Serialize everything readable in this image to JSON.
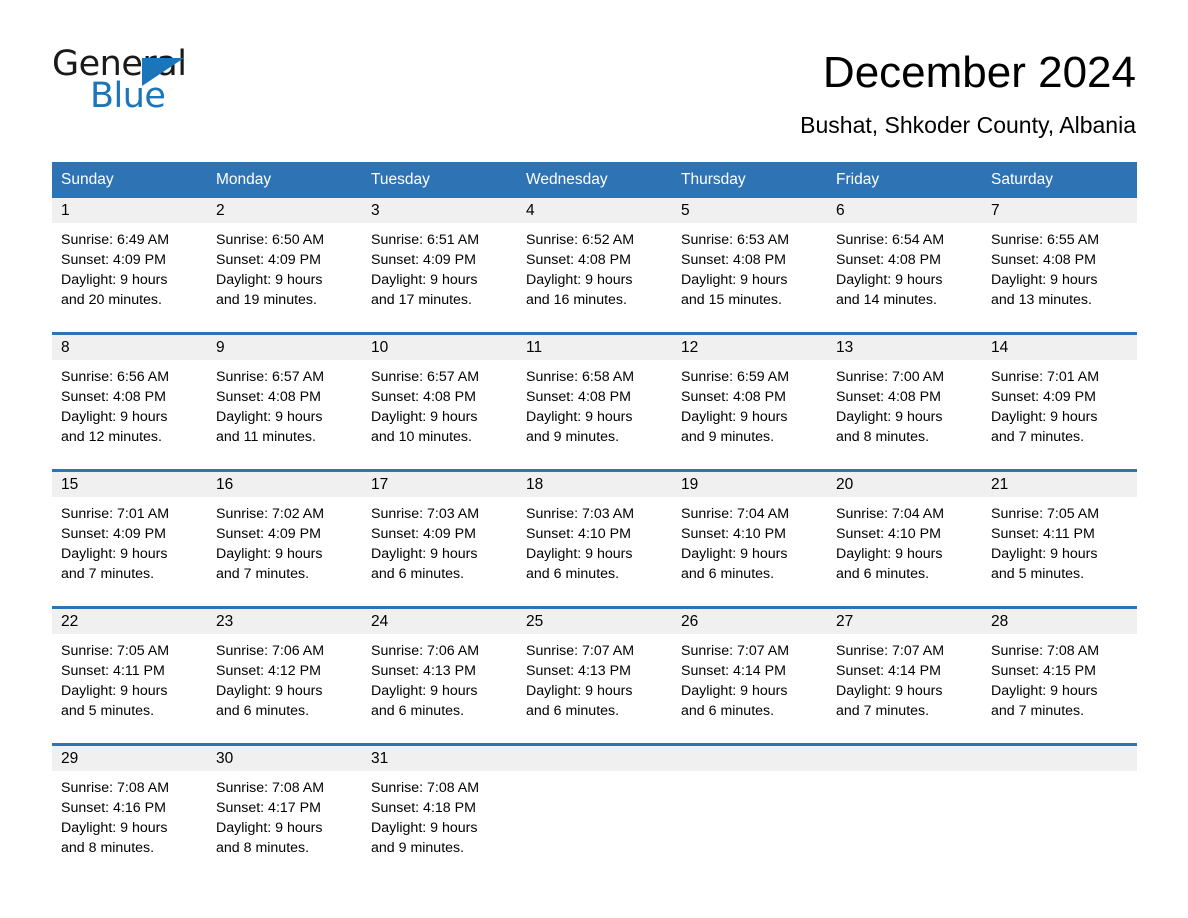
{
  "logo": {
    "word_one": "General",
    "word_two": "Blue",
    "accent_color": "#1b75bb"
  },
  "header": {
    "title": "December 2024",
    "location": "Bushat, Shkoder County, Albania",
    "header_bg_color": "#2e74b5",
    "daynum_bg_color": "#f0f0f0"
  },
  "weekdays": [
    "Sunday",
    "Monday",
    "Tuesday",
    "Wednesday",
    "Thursday",
    "Friday",
    "Saturday"
  ],
  "weeks": [
    [
      {
        "day": "1",
        "sunrise": "Sunrise: 6:49 AM",
        "sunset": "Sunset: 4:09 PM",
        "daylight_line1": "Daylight: 9 hours",
        "daylight_line2": "and 20 minutes."
      },
      {
        "day": "2",
        "sunrise": "Sunrise: 6:50 AM",
        "sunset": "Sunset: 4:09 PM",
        "daylight_line1": "Daylight: 9 hours",
        "daylight_line2": "and 19 minutes."
      },
      {
        "day": "3",
        "sunrise": "Sunrise: 6:51 AM",
        "sunset": "Sunset: 4:09 PM",
        "daylight_line1": "Daylight: 9 hours",
        "daylight_line2": "and 17 minutes."
      },
      {
        "day": "4",
        "sunrise": "Sunrise: 6:52 AM",
        "sunset": "Sunset: 4:08 PM",
        "daylight_line1": "Daylight: 9 hours",
        "daylight_line2": "and 16 minutes."
      },
      {
        "day": "5",
        "sunrise": "Sunrise: 6:53 AM",
        "sunset": "Sunset: 4:08 PM",
        "daylight_line1": "Daylight: 9 hours",
        "daylight_line2": "and 15 minutes."
      },
      {
        "day": "6",
        "sunrise": "Sunrise: 6:54 AM",
        "sunset": "Sunset: 4:08 PM",
        "daylight_line1": "Daylight: 9 hours",
        "daylight_line2": "and 14 minutes."
      },
      {
        "day": "7",
        "sunrise": "Sunrise: 6:55 AM",
        "sunset": "Sunset: 4:08 PM",
        "daylight_line1": "Daylight: 9 hours",
        "daylight_line2": "and 13 minutes."
      }
    ],
    [
      {
        "day": "8",
        "sunrise": "Sunrise: 6:56 AM",
        "sunset": "Sunset: 4:08 PM",
        "daylight_line1": "Daylight: 9 hours",
        "daylight_line2": "and 12 minutes."
      },
      {
        "day": "9",
        "sunrise": "Sunrise: 6:57 AM",
        "sunset": "Sunset: 4:08 PM",
        "daylight_line1": "Daylight: 9 hours",
        "daylight_line2": "and 11 minutes."
      },
      {
        "day": "10",
        "sunrise": "Sunrise: 6:57 AM",
        "sunset": "Sunset: 4:08 PM",
        "daylight_line1": "Daylight: 9 hours",
        "daylight_line2": "and 10 minutes."
      },
      {
        "day": "11",
        "sunrise": "Sunrise: 6:58 AM",
        "sunset": "Sunset: 4:08 PM",
        "daylight_line1": "Daylight: 9 hours",
        "daylight_line2": "and 9 minutes."
      },
      {
        "day": "12",
        "sunrise": "Sunrise: 6:59 AM",
        "sunset": "Sunset: 4:08 PM",
        "daylight_line1": "Daylight: 9 hours",
        "daylight_line2": "and 9 minutes."
      },
      {
        "day": "13",
        "sunrise": "Sunrise: 7:00 AM",
        "sunset": "Sunset: 4:08 PM",
        "daylight_line1": "Daylight: 9 hours",
        "daylight_line2": "and 8 minutes."
      },
      {
        "day": "14",
        "sunrise": "Sunrise: 7:01 AM",
        "sunset": "Sunset: 4:09 PM",
        "daylight_line1": "Daylight: 9 hours",
        "daylight_line2": "and 7 minutes."
      }
    ],
    [
      {
        "day": "15",
        "sunrise": "Sunrise: 7:01 AM",
        "sunset": "Sunset: 4:09 PM",
        "daylight_line1": "Daylight: 9 hours",
        "daylight_line2": "and 7 minutes."
      },
      {
        "day": "16",
        "sunrise": "Sunrise: 7:02 AM",
        "sunset": "Sunset: 4:09 PM",
        "daylight_line1": "Daylight: 9 hours",
        "daylight_line2": "and 7 minutes."
      },
      {
        "day": "17",
        "sunrise": "Sunrise: 7:03 AM",
        "sunset": "Sunset: 4:09 PM",
        "daylight_line1": "Daylight: 9 hours",
        "daylight_line2": "and 6 minutes."
      },
      {
        "day": "18",
        "sunrise": "Sunrise: 7:03 AM",
        "sunset": "Sunset: 4:10 PM",
        "daylight_line1": "Daylight: 9 hours",
        "daylight_line2": "and 6 minutes."
      },
      {
        "day": "19",
        "sunrise": "Sunrise: 7:04 AM",
        "sunset": "Sunset: 4:10 PM",
        "daylight_line1": "Daylight: 9 hours",
        "daylight_line2": "and 6 minutes."
      },
      {
        "day": "20",
        "sunrise": "Sunrise: 7:04 AM",
        "sunset": "Sunset: 4:10 PM",
        "daylight_line1": "Daylight: 9 hours",
        "daylight_line2": "and 6 minutes."
      },
      {
        "day": "21",
        "sunrise": "Sunrise: 7:05 AM",
        "sunset": "Sunset: 4:11 PM",
        "daylight_line1": "Daylight: 9 hours",
        "daylight_line2": "and 5 minutes."
      }
    ],
    [
      {
        "day": "22",
        "sunrise": "Sunrise: 7:05 AM",
        "sunset": "Sunset: 4:11 PM",
        "daylight_line1": "Daylight: 9 hours",
        "daylight_line2": "and 5 minutes."
      },
      {
        "day": "23",
        "sunrise": "Sunrise: 7:06 AM",
        "sunset": "Sunset: 4:12 PM",
        "daylight_line1": "Daylight: 9 hours",
        "daylight_line2": "and 6 minutes."
      },
      {
        "day": "24",
        "sunrise": "Sunrise: 7:06 AM",
        "sunset": "Sunset: 4:13 PM",
        "daylight_line1": "Daylight: 9 hours",
        "daylight_line2": "and 6 minutes."
      },
      {
        "day": "25",
        "sunrise": "Sunrise: 7:07 AM",
        "sunset": "Sunset: 4:13 PM",
        "daylight_line1": "Daylight: 9 hours",
        "daylight_line2": "and 6 minutes."
      },
      {
        "day": "26",
        "sunrise": "Sunrise: 7:07 AM",
        "sunset": "Sunset: 4:14 PM",
        "daylight_line1": "Daylight: 9 hours",
        "daylight_line2": "and 6 minutes."
      },
      {
        "day": "27",
        "sunrise": "Sunrise: 7:07 AM",
        "sunset": "Sunset: 4:14 PM",
        "daylight_line1": "Daylight: 9 hours",
        "daylight_line2": "and 7 minutes."
      },
      {
        "day": "28",
        "sunrise": "Sunrise: 7:08 AM",
        "sunset": "Sunset: 4:15 PM",
        "daylight_line1": "Daylight: 9 hours",
        "daylight_line2": "and 7 minutes."
      }
    ],
    [
      {
        "day": "29",
        "sunrise": "Sunrise: 7:08 AM",
        "sunset": "Sunset: 4:16 PM",
        "daylight_line1": "Daylight: 9 hours",
        "daylight_line2": "and 8 minutes."
      },
      {
        "day": "30",
        "sunrise": "Sunrise: 7:08 AM",
        "sunset": "Sunset: 4:17 PM",
        "daylight_line1": "Daylight: 9 hours",
        "daylight_line2": "and 8 minutes."
      },
      {
        "day": "31",
        "sunrise": "Sunrise: 7:08 AM",
        "sunset": "Sunset: 4:18 PM",
        "daylight_line1": "Daylight: 9 hours",
        "daylight_line2": "and 9 minutes."
      },
      {
        "day": "",
        "sunrise": "",
        "sunset": "",
        "daylight_line1": "",
        "daylight_line2": ""
      },
      {
        "day": "",
        "sunrise": "",
        "sunset": "",
        "daylight_line1": "",
        "daylight_line2": ""
      },
      {
        "day": "",
        "sunrise": "",
        "sunset": "",
        "daylight_line1": "",
        "daylight_line2": ""
      },
      {
        "day": "",
        "sunrise": "",
        "sunset": "",
        "daylight_line1": "",
        "daylight_line2": ""
      }
    ]
  ]
}
